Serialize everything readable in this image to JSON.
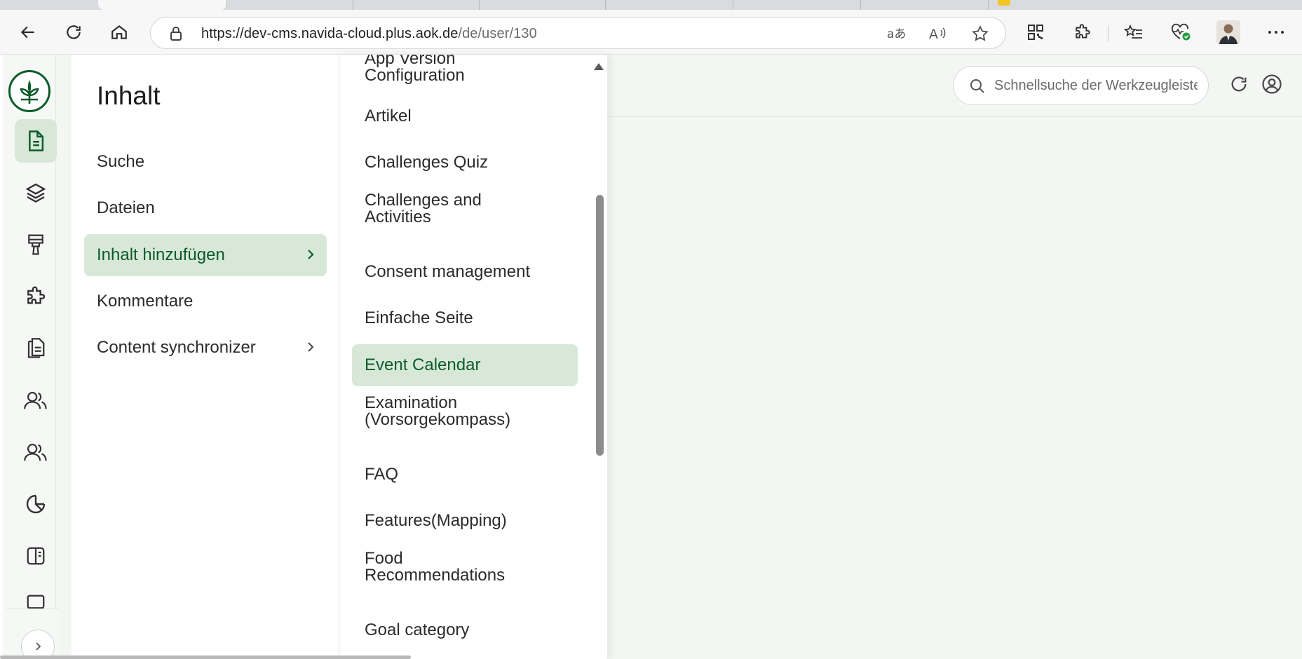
{
  "browser": {
    "url_host": "https://dev-cms.navida-cloud.plus.aok.de",
    "url_path": "/de/user/130"
  },
  "colors": {
    "brand": "#0c5c2b",
    "active_bg": "#d8e8d8"
  },
  "rail": {
    "icons": [
      "document-icon",
      "layers-icon",
      "brush-icon",
      "puzzle-icon",
      "pages-icon",
      "users-icon",
      "groups-icon",
      "pie-chart-icon",
      "layout-icon",
      "monitor-icon"
    ]
  },
  "panel1": {
    "title": "Inhalt",
    "items": [
      {
        "label": "Suche"
      },
      {
        "label": "Dateien"
      },
      {
        "label": "Inhalt hinzufügen"
      },
      {
        "label": "Kommentare"
      },
      {
        "label": "Content synchronizer"
      }
    ]
  },
  "panel2": {
    "items": [
      {
        "label": "App Version Configuration"
      },
      {
        "label": "Artikel"
      },
      {
        "label": "Challenges Quiz"
      },
      {
        "label": "Challenges and Activities"
      },
      {
        "label": "Consent management"
      },
      {
        "label": "Einfache Seite"
      },
      {
        "label": "Event Calendar"
      },
      {
        "label": "Examination (Vorsorgekompass)"
      },
      {
        "label": "FAQ"
      },
      {
        "label": "Features(Mapping)"
      },
      {
        "label": "Food Recommendations"
      },
      {
        "label": "Goal category"
      }
    ]
  },
  "header": {
    "search_placeholder": "Schnellsuche der Werkzeugleiste"
  }
}
